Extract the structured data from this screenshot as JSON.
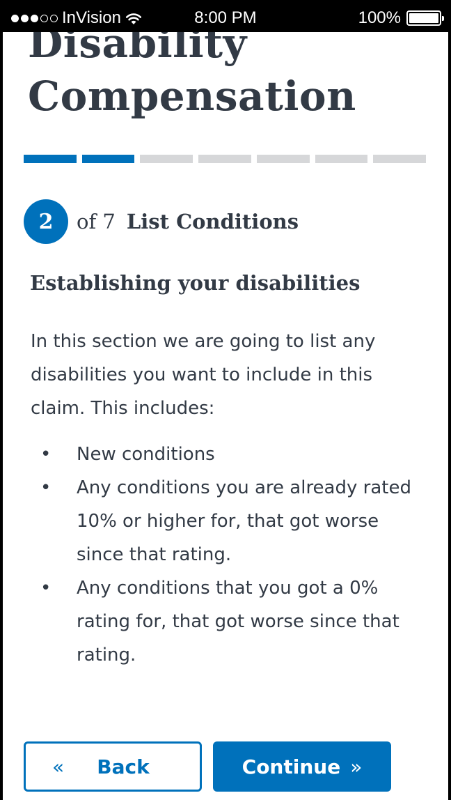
{
  "status_bar": {
    "carrier": "InVision",
    "time": "8:00 PM",
    "battery_text": "100%",
    "signal_bars": 5,
    "signal_filled": 3,
    "battery_level": 1.0
  },
  "header": {
    "title": "Disability Compensation"
  },
  "progress": {
    "total_steps": 7,
    "completed_steps": 2,
    "active_color": "#0071bb",
    "inactive_color": "#d6d7d9"
  },
  "step": {
    "number": "2",
    "of_text": "of 7",
    "name": "List Conditions"
  },
  "section": {
    "heading": "Establishing your disabilities",
    "intro": "In this section we are going to list any disabilities you want to include in this claim. This includes:",
    "bullets": [
      "New conditions",
      "Any conditions you are already rated 10% or higher for, that got worse since that rating.",
      "Any conditions that you got a 0% rating for, that got worse since that rating."
    ]
  },
  "actions": {
    "back_label": "Back",
    "back_icon": "«",
    "continue_label": "Continue",
    "continue_icon": "»"
  },
  "colors": {
    "primary": "#0071bb",
    "text": "#323a45"
  }
}
